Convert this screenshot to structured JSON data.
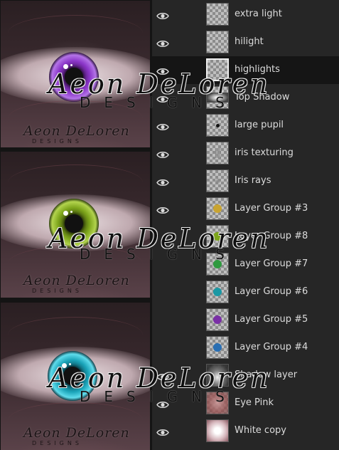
{
  "watermark": {
    "signature": "Aeon DeLoren",
    "sub": "DESIGNS"
  },
  "layers": [
    {
      "name": "extra light",
      "visible": true,
      "thumb": "checker",
      "selected": false
    },
    {
      "name": "hilight",
      "visible": true,
      "thumb": "checker",
      "selected": false
    },
    {
      "name": "highlights",
      "visible": true,
      "thumb": "checker",
      "selected": true
    },
    {
      "name": "Top Shadow",
      "visible": true,
      "thumb": "shadowtop",
      "selected": false
    },
    {
      "name": "large pupil",
      "visible": true,
      "thumb": "pupil",
      "selected": false
    },
    {
      "name": "iris texturing",
      "visible": true,
      "thumb": "iristex",
      "selected": false
    },
    {
      "name": "Iris rays",
      "visible": true,
      "thumb": "irisrays",
      "selected": false
    },
    {
      "name": "Layer Group #3",
      "visible": true,
      "thumb": "dot",
      "dot_color": "#c9a431",
      "selected": false
    },
    {
      "name": "Layer Group #8",
      "visible": false,
      "thumb": "dot",
      "dot_color": "#7ea61c",
      "selected": false
    },
    {
      "name": "Layer Group #7",
      "visible": false,
      "thumb": "dot",
      "dot_color": "#2f9a3f",
      "selected": false
    },
    {
      "name": "Layer Group #6",
      "visible": false,
      "thumb": "dot",
      "dot_color": "#1a98a4",
      "selected": false
    },
    {
      "name": "Layer Group #5",
      "visible": false,
      "thumb": "dot",
      "dot_color": "#7a2fa6",
      "selected": false
    },
    {
      "name": "Layer Group #4",
      "visible": false,
      "thumb": "dot",
      "dot_color": "#2a6fb3",
      "selected": false
    },
    {
      "name": "Shadow layer",
      "visible": true,
      "thumb": "shadowlayer",
      "selected": false
    },
    {
      "name": "Eye Pink",
      "visible": true,
      "thumb": "eyepink",
      "selected": false
    },
    {
      "name": "White copy",
      "visible": true,
      "thumb": "whitecopy",
      "selected": false
    }
  ],
  "icons": {
    "visibility": "eye-icon"
  },
  "colors": {
    "panel_bg": "#262626",
    "selected_row": "#151515",
    "text": "#dcdcdc"
  }
}
